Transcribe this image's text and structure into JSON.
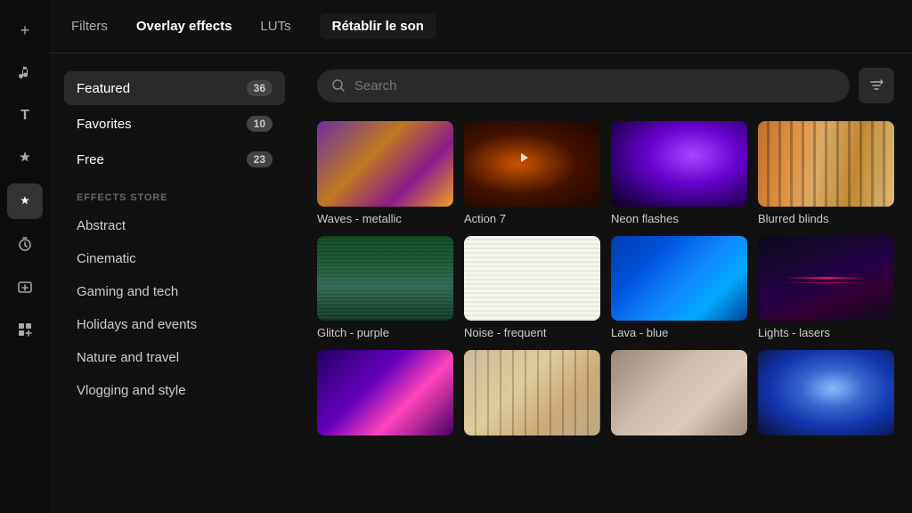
{
  "sidebar": {
    "icons": [
      {
        "name": "add-icon",
        "symbol": "+",
        "active": false
      },
      {
        "name": "music-icon",
        "symbol": "♪",
        "active": false
      },
      {
        "name": "text-icon",
        "symbol": "T",
        "active": false
      },
      {
        "name": "effects-icon",
        "symbol": "✦",
        "active": false
      },
      {
        "name": "magic-icon",
        "symbol": "◆",
        "active": true
      },
      {
        "name": "timer-icon",
        "symbol": "◔",
        "active": false
      },
      {
        "name": "addclip-icon",
        "symbol": "⊕",
        "active": false
      },
      {
        "name": "apps-icon",
        "symbol": "⠿",
        "active": false
      }
    ]
  },
  "topnav": {
    "items": [
      {
        "label": "Filters",
        "active": false,
        "highlight": false
      },
      {
        "label": "Overlay effects",
        "active": true,
        "highlight": false
      },
      {
        "label": "LUTs",
        "active": false,
        "highlight": false
      },
      {
        "label": "Rétablir le son",
        "active": false,
        "highlight": true
      }
    ]
  },
  "leftpanel": {
    "categories": [
      {
        "label": "Featured",
        "count": "36",
        "active": true
      },
      {
        "label": "Favorites",
        "count": "10",
        "active": false
      },
      {
        "label": "Free",
        "count": "23",
        "active": false
      }
    ],
    "store_header": "EFFECTS STORE",
    "store_items": [
      "Abstract",
      "Cinematic",
      "Gaming and tech",
      "Holidays and events",
      "Nature and travel",
      "Vlogging and style"
    ]
  },
  "search": {
    "placeholder": "Search"
  },
  "effects": [
    {
      "label": "Waves - metallic",
      "thumb": "waves"
    },
    {
      "label": "Action 7",
      "thumb": "action"
    },
    {
      "label": "Neon flashes",
      "thumb": "neon"
    },
    {
      "label": "Blurred blinds",
      "thumb": "blurred"
    },
    {
      "label": "Glitch - purple",
      "thumb": "glitch"
    },
    {
      "label": "Noise - frequent",
      "thumb": "noise"
    },
    {
      "label": "Lava - blue",
      "thumb": "lava"
    },
    {
      "label": "Lights - lasers",
      "thumb": "lights"
    },
    {
      "label": "",
      "thumb": "bottom1"
    },
    {
      "label": "",
      "thumb": "bottom2"
    },
    {
      "label": "",
      "thumb": "bottom3"
    },
    {
      "label": "",
      "thumb": "bottom4"
    }
  ]
}
